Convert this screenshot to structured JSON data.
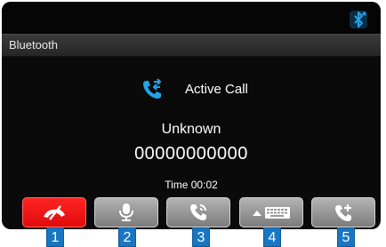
{
  "header": {
    "title": "Bluetooth"
  },
  "call": {
    "status": "Active Call",
    "caller_name": "Unknown",
    "caller_number": "00000000000",
    "time": "Time 00:02"
  },
  "buttons": [
    {
      "icon": "end-call-icon",
      "color": "#ff1f1f"
    },
    {
      "icon": "microphone-icon"
    },
    {
      "icon": "privacy-mode-icon"
    },
    {
      "icon": "keypad-icon"
    },
    {
      "icon": "add-call-icon"
    }
  ],
  "callouts": [
    "1",
    "2",
    "3",
    "4",
    "5"
  ],
  "colors": {
    "accent_blue": "#22a3e6",
    "end_call_red": "#ff1f1f",
    "callout_blue": "#1876c2"
  }
}
